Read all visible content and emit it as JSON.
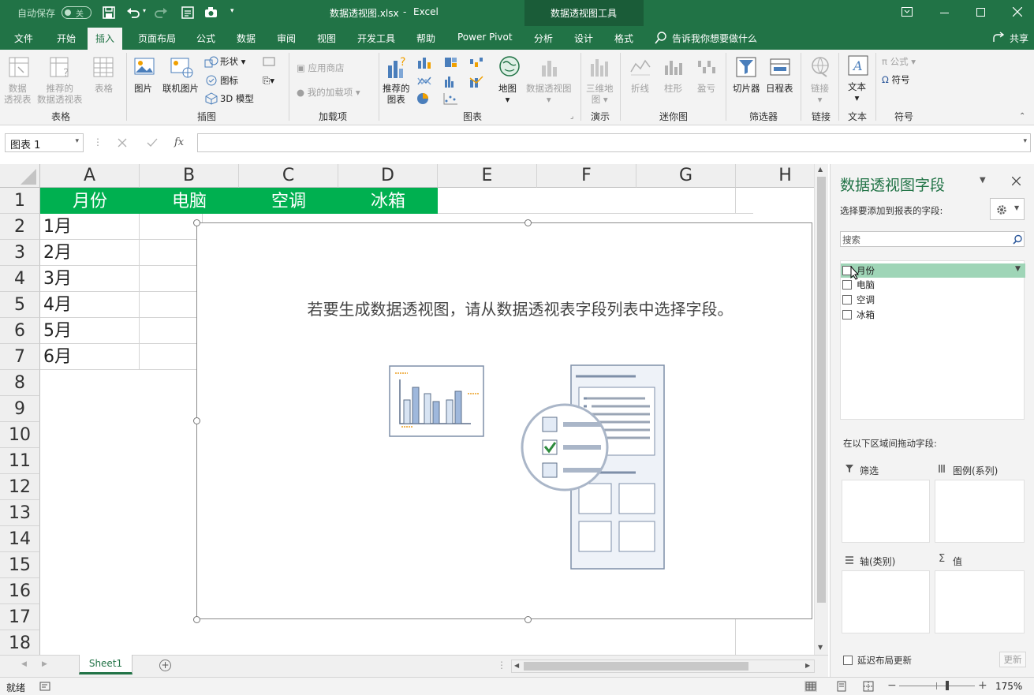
{
  "titlebar": {
    "autosave_label": "自动保存",
    "autosave_state": "关",
    "filename": "数据透视图.xlsx",
    "separator": "-",
    "app": "Excel",
    "context_tools": "数据透视图工具"
  },
  "tabs": [
    "文件",
    "开始",
    "插入",
    "页面布局",
    "公式",
    "数据",
    "审阅",
    "视图",
    "开发工具",
    "帮助",
    "Power Pivot",
    "分析",
    "设计",
    "格式"
  ],
  "tell_me": "告诉我你想要做什么",
  "share": "共享",
  "ribbon": {
    "tables": {
      "label": "表格",
      "pivot_table": [
        "数据",
        "透视表"
      ],
      "recommended": [
        "推荐的",
        "数据透视表"
      ],
      "table": "表格"
    },
    "illustrations": {
      "label": "插图",
      "picture": "图片",
      "online_picture": "联机图片",
      "shapes": "形状",
      "icons": "图标",
      "model3d": "3D 模型"
    },
    "addins": {
      "label": "加载项",
      "store": "应用商店",
      "my_addins": "我的加载项"
    },
    "charts": {
      "label": "图表",
      "recommended": [
        "推荐的",
        "图表"
      ],
      "map": "地图",
      "pivot_chart": "数据透视图"
    },
    "tours": {
      "label": "演示",
      "map3d": [
        "三维地",
        "图"
      ]
    },
    "sparklines": {
      "label": "迷你图",
      "line": "折线",
      "column": "柱形",
      "winloss": "盈亏"
    },
    "filters": {
      "label": "筛选器",
      "slicer": "切片器",
      "timeline": "日程表"
    },
    "links": {
      "label": "链接",
      "link": "链接"
    },
    "text": {
      "label": "文本",
      "text": "文本"
    },
    "symbols": {
      "label": "符号",
      "equation": "公式",
      "symbol": "符号"
    }
  },
  "namebox": "图表 1",
  "columns": [
    "A",
    "B",
    "C",
    "D",
    "E",
    "F",
    "G",
    "H"
  ],
  "rows": [
    "1",
    "2",
    "3",
    "4",
    "5",
    "6",
    "7",
    "8",
    "9",
    "10",
    "11",
    "12",
    "13",
    "14",
    "15",
    "16",
    "17",
    "18"
  ],
  "header_cells": [
    "月份",
    "电脑",
    "空调",
    "冰箱"
  ],
  "months": [
    "1月",
    "2月",
    "3月",
    "4月",
    "5月",
    "6月"
  ],
  "chart_message": "若要生成数据透视图，请从数据透视表字段列表中选择字段。",
  "pane": {
    "title": "数据透视图字段",
    "choose_label": "选择要添加到报表的字段:",
    "search_placeholder": "搜索",
    "fields": [
      "月份",
      "电脑",
      "空调",
      "冰箱"
    ],
    "drag_label": "在以下区域间拖动字段:",
    "filters": "筛选",
    "legend": "图例(系列)",
    "axis": "轴(类别)",
    "values": "值",
    "defer": "延迟布局更新",
    "update": "更新"
  },
  "sheet_tab": "Sheet1",
  "status": {
    "ready": "就绪",
    "zoom": "175%"
  },
  "colors": {
    "excel_green": "#217346",
    "header_fill": "#00b050",
    "field_highlight": "#9fd5b7"
  }
}
